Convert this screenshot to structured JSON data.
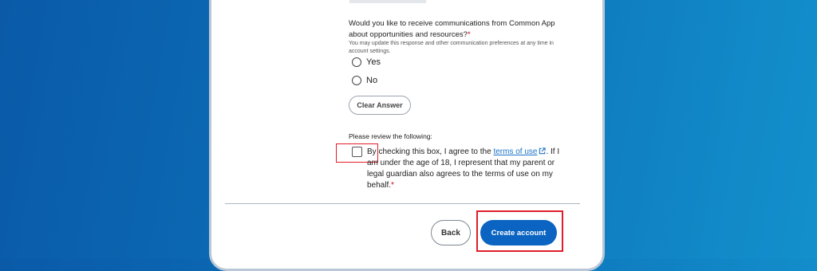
{
  "form": {
    "question": "Would you like to receive communications from Common App about opportunities and resources?",
    "required_mark": "*",
    "hint": "You may update this response and other communication preferences at any time in account settings.",
    "options": [
      {
        "label": "Yes",
        "selected": false
      },
      {
        "label": "No",
        "selected": false
      }
    ],
    "clear_label": "Clear Answer",
    "review_label": "Please review the following:",
    "terms_before": "By checking this box, I agree to the ",
    "terms_link": "terms of use",
    "terms_after": ". If I am under the age of 18, I represent that my parent or legal guardian also agrees to the terms of use on my behalf.",
    "terms_checked": false
  },
  "footer": {
    "back_label": "Back",
    "create_label": "Create account"
  },
  "colors": {
    "background": "#0d74bb",
    "primary": "#0b64c2",
    "link": "#1a73c8",
    "required": "#d0021b",
    "highlight": "#e01e2a"
  },
  "icons": {
    "external_link": "external-link-icon"
  }
}
